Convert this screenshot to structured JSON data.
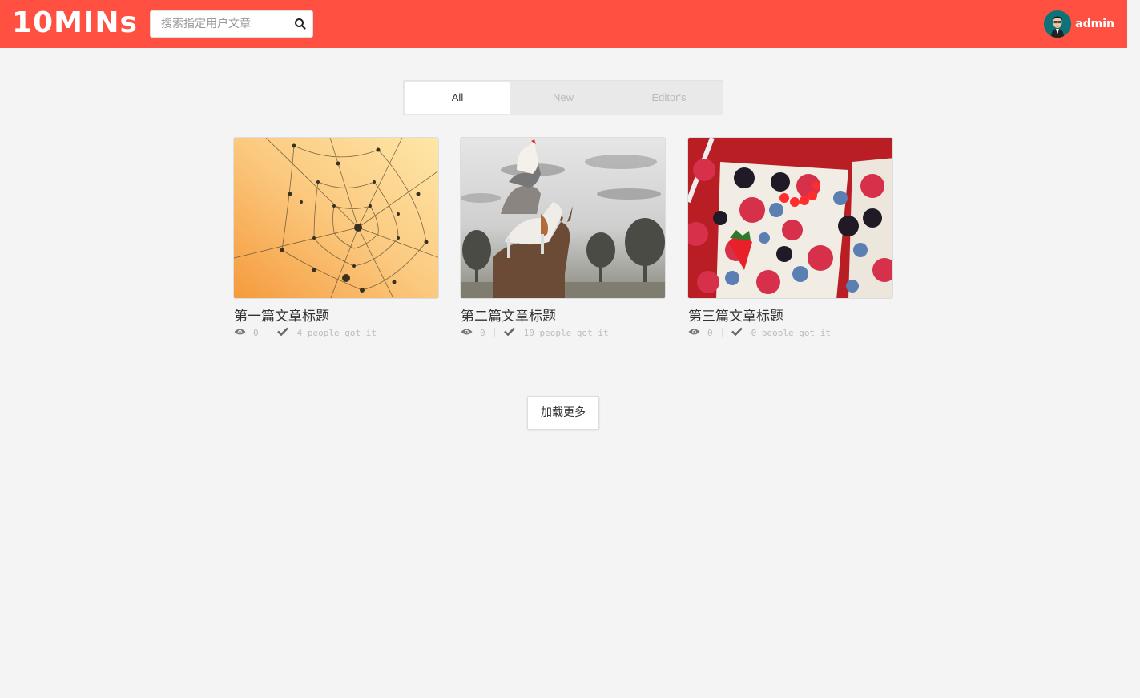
{
  "header": {
    "logo": "10MINs",
    "search_placeholder": "搜索指定用户文章",
    "username": "admin",
    "brand_color": "#ff5042"
  },
  "tabs": [
    {
      "label": "All",
      "active": true
    },
    {
      "label": "New",
      "active": false
    },
    {
      "label": "Editor's",
      "active": false
    }
  ],
  "articles": [
    {
      "title": "第一篇文章标题",
      "views": "0",
      "got_it": "4 people got it",
      "image": "dewdrop-spiderweb"
    },
    {
      "title": "第二篇文章标题",
      "views": "0",
      "got_it": "10 people got it",
      "image": "stacked-animals"
    },
    {
      "title": "第三篇文章标题",
      "views": "0",
      "got_it": "0 people got it",
      "image": "berries"
    }
  ],
  "load_more_label": "加载更多",
  "icons": {
    "search": "search-icon",
    "views": "eye-icon",
    "got_it": "check-icon"
  }
}
